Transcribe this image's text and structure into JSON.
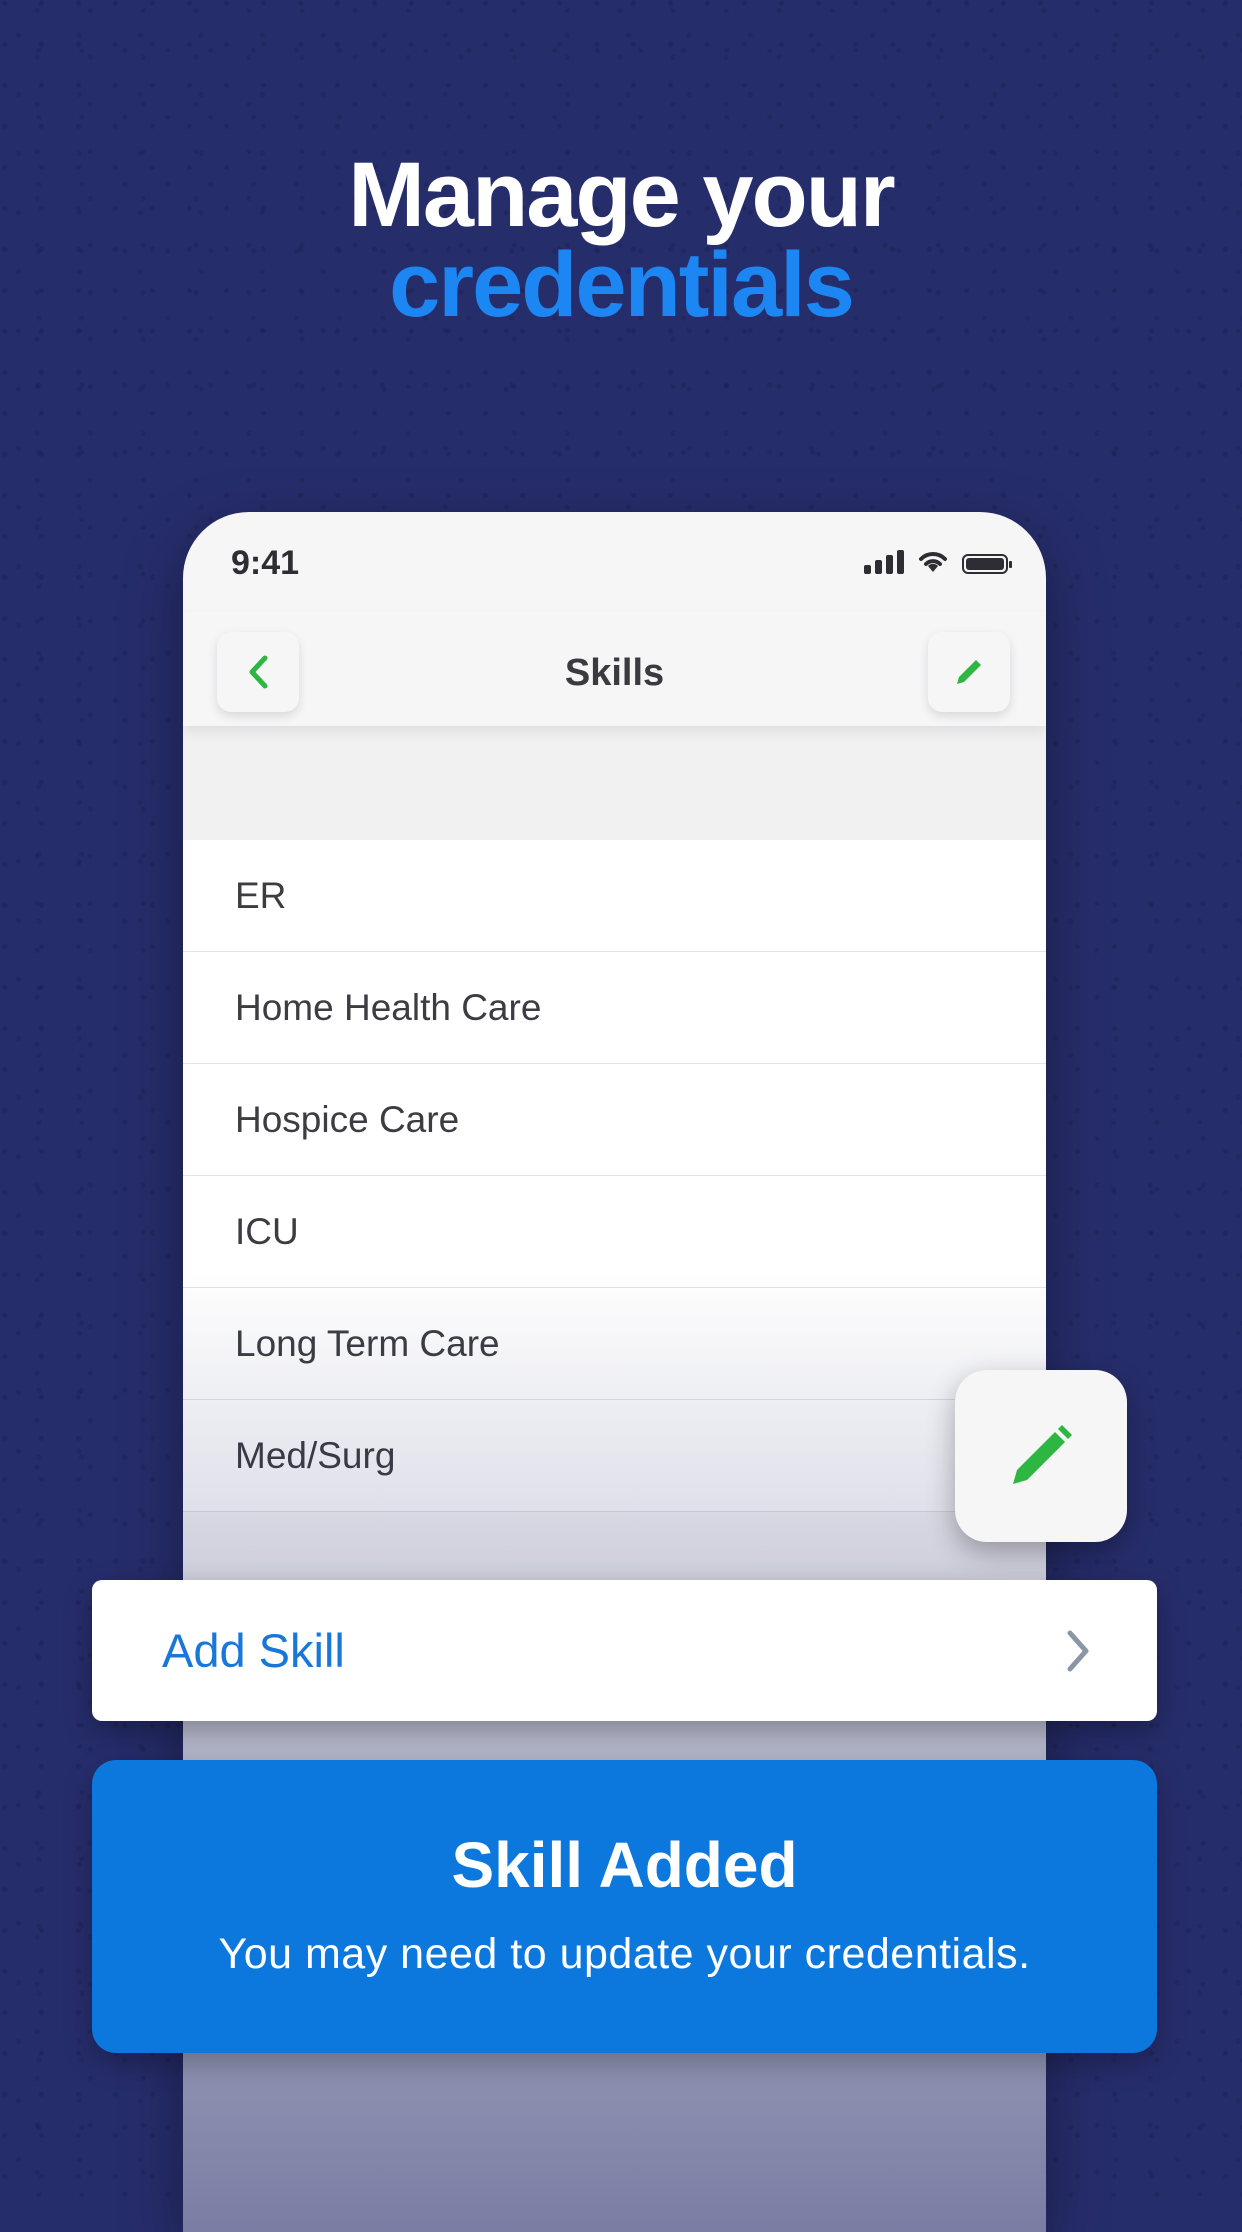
{
  "headline": {
    "line1": "Manage your",
    "line2": "credentials"
  },
  "status_bar": {
    "time": "9:41"
  },
  "nav": {
    "title": "Skills"
  },
  "skills": [
    "ER",
    "Home Health Care",
    "Hospice Care",
    "ICU",
    "Long Term Care",
    "Med/Surg"
  ],
  "add_skill": {
    "label": "Add Skill"
  },
  "toast": {
    "title": "Skill Added",
    "message": "You may need to update your credentials."
  },
  "colors": {
    "background": "#262d6b",
    "accent": "#1c86f2",
    "toast": "#0c78de",
    "green_icon": "#2db742"
  },
  "icons": [
    "back-chevron-icon",
    "pencil-icon",
    "chevron-right-icon",
    "signal-icon",
    "wifi-icon",
    "battery-icon"
  ]
}
